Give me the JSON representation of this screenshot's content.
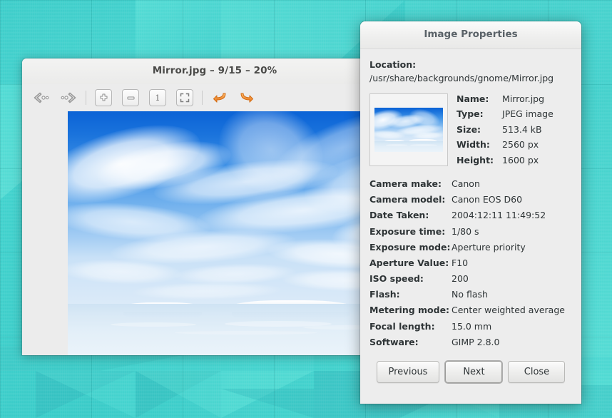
{
  "desktop": {
    "wallpaper_name": "teal-geometric-wallpaper",
    "base_color": "#3fd0cf"
  },
  "viewer": {
    "title": "Mirror.jpg – 9/15 – 20%",
    "filename": "Mirror.jpg",
    "position": "9/15",
    "zoom_level": "20%",
    "toolbar": {
      "previous_label": "Previous Image",
      "next_label": "Next Image",
      "zoom_in_label": "Zoom In",
      "zoom_out_label": "Zoom Out",
      "normal_size_label": "Normal Size",
      "best_fit_label": "Best Fit",
      "rotate_ccw_label": "Rotate Counterclockwise",
      "rotate_cw_label": "Rotate Clockwise",
      "normal_size_glyph": "1"
    },
    "image_alt": "Blue sky with cirrus clouds over a mirror lake with snow-capped mountains"
  },
  "dialog": {
    "title": "Image Properties",
    "location_label": "Location:",
    "location_value": "/usr/share/backgrounds/gnome/Mirror.jpg",
    "thumbnail_alt": "Mirror.jpg thumbnail",
    "basic": [
      {
        "key": "Name:",
        "value": "Mirror.jpg"
      },
      {
        "key": "Type:",
        "value": "JPEG image"
      },
      {
        "key": "Size:",
        "value": "513.4 kB"
      },
      {
        "key": "Width:",
        "value": "2560 px"
      },
      {
        "key": "Height:",
        "value": "1600 px"
      }
    ],
    "exif": [
      {
        "key": "Camera make:",
        "value": "Canon"
      },
      {
        "key": "Camera model:",
        "value": "Canon EOS D60"
      },
      {
        "key": "Date Taken:",
        "value": "2004:12:11 11:49:52"
      },
      {
        "key": "Exposure time:",
        "value": "1/80 s"
      },
      {
        "key": "Exposure mode:",
        "value": "Aperture priority"
      },
      {
        "key": "Aperture Value:",
        "value": "F10"
      },
      {
        "key": "ISO speed:",
        "value": "200"
      },
      {
        "key": "Flash:",
        "value": "No flash"
      },
      {
        "key": "Metering mode:",
        "value": "Center weighted average"
      },
      {
        "key": "Focal length:",
        "value": "15.0 mm"
      },
      {
        "key": "Software:",
        "value": "GIMP 2.8.0"
      }
    ],
    "buttons": {
      "previous": "Previous",
      "next": "Next",
      "close": "Close",
      "focused": "Next"
    }
  }
}
